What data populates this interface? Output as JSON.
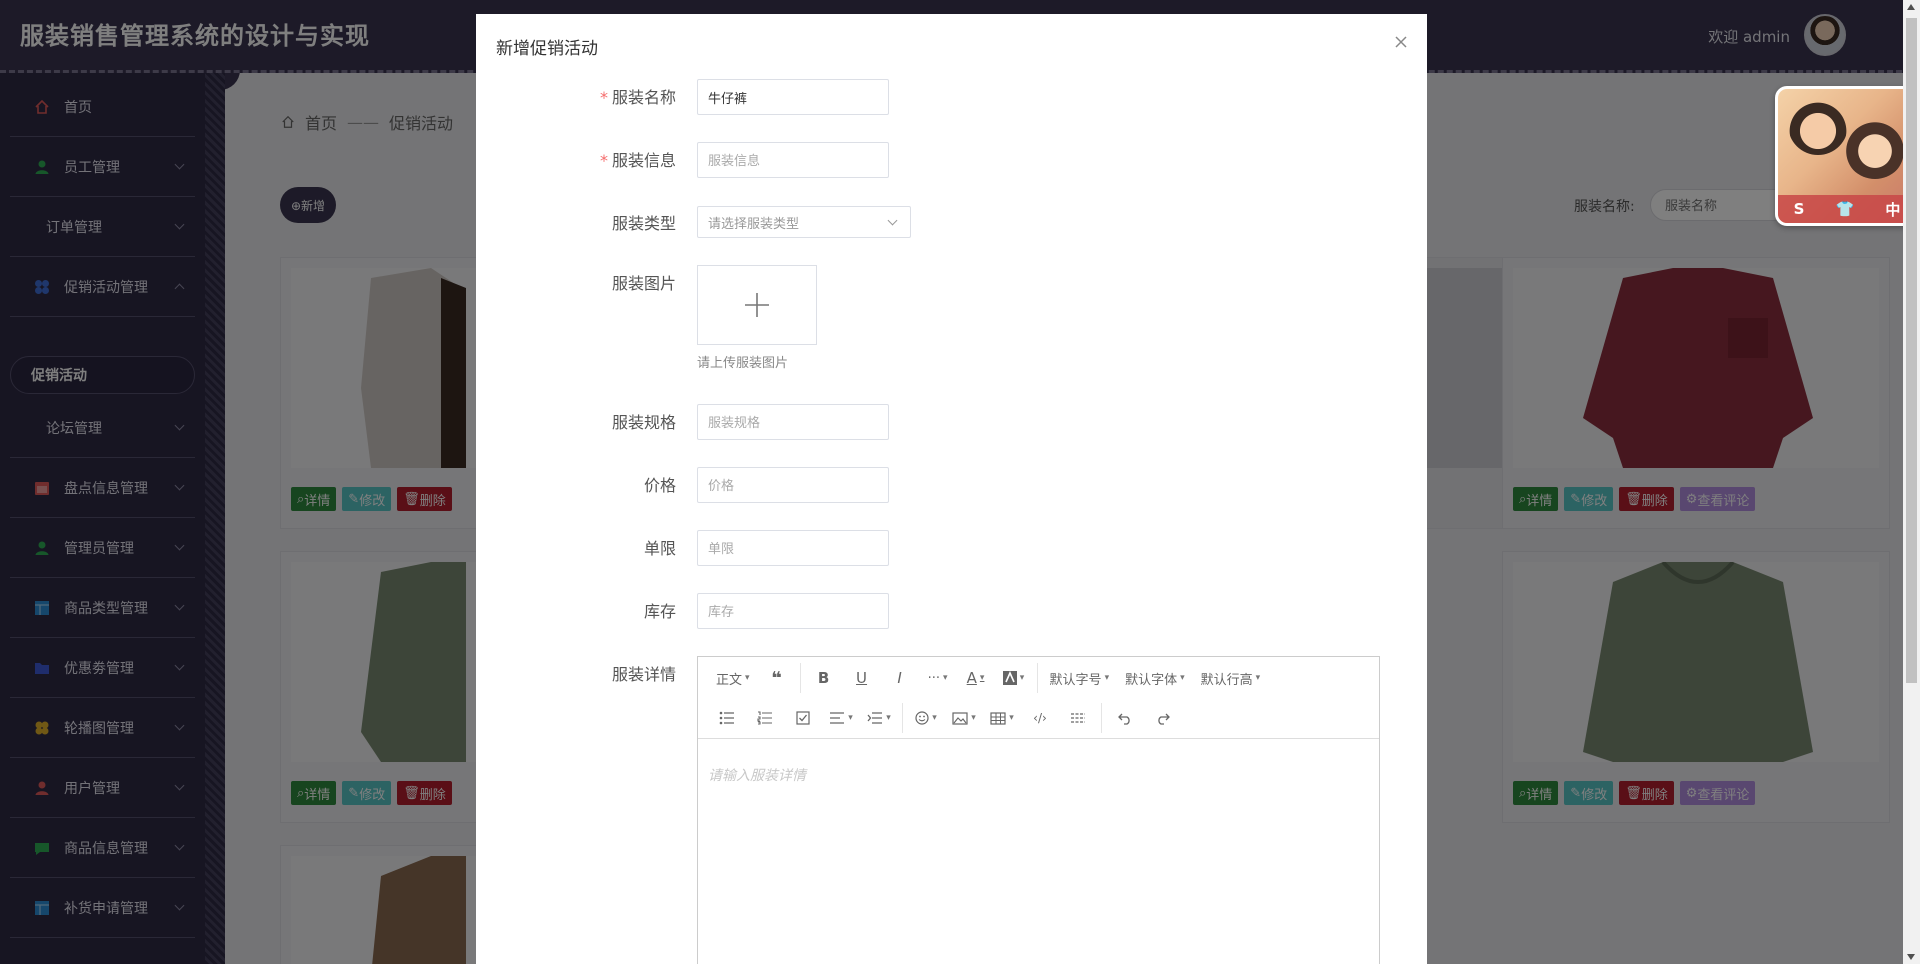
{
  "app": {
    "title": "服装销售管理系统的设计与实现",
    "welcome": "欢迎 admin"
  },
  "sidebar": {
    "items": [
      {
        "label": "首页",
        "icon": "home-icon",
        "color": "#e05a5a"
      },
      {
        "label": "员工管理",
        "icon": "person-icon",
        "color": "#2fae55"
      },
      {
        "label": "订单管理",
        "icon": "",
        "color": ""
      },
      {
        "label": "促销活动管理",
        "icon": "grid-icon",
        "color": "#3f6fd8"
      },
      {
        "label": "论坛管理",
        "icon": "",
        "color": ""
      },
      {
        "label": "盘点信息管理",
        "icon": "calendar-icon",
        "color": "#e05a5a"
      },
      {
        "label": "管理员管理",
        "icon": "person-icon",
        "color": "#2fae55"
      },
      {
        "label": "商品类型管理",
        "icon": "table-icon",
        "color": "#2d8fd8"
      },
      {
        "label": "优惠劵管理",
        "icon": "folder-icon",
        "color": "#3f5bd8"
      },
      {
        "label": "轮播图管理",
        "icon": "clover-icon",
        "color": "#e0b02a"
      },
      {
        "label": "用户管理",
        "icon": "person-icon",
        "color": "#e05a5a"
      },
      {
        "label": "商品信息管理",
        "icon": "chat-icon",
        "color": "#2fae55"
      },
      {
        "label": "补货申请管理",
        "icon": "table-icon",
        "color": "#2d8fd8"
      }
    ],
    "active_sub": "促销活动"
  },
  "breadcrumb": {
    "home": "首页",
    "current": "促销活动"
  },
  "toolbar": {
    "add_label": "⊕新增",
    "search_label": "服装名称:",
    "search_placeholder": "服装名称"
  },
  "card_actions": {
    "detail": "详情",
    "edit": "修改",
    "delete": "删除",
    "review": "查看评论"
  },
  "dialog": {
    "title": "新增促销活动",
    "fields": {
      "name": {
        "label": "服装名称",
        "value": "牛仔裤",
        "required": true
      },
      "info": {
        "label": "服装信息",
        "placeholder": "服装信息",
        "required": true
      },
      "type": {
        "label": "服装类型",
        "placeholder": "请选择服装类型"
      },
      "image": {
        "label": "服装图片",
        "tip": "请上传服装图片"
      },
      "spec": {
        "label": "服装规格",
        "placeholder": "服装规格"
      },
      "price": {
        "label": "价格",
        "placeholder": "价格"
      },
      "limit": {
        "label": "单限",
        "placeholder": "单限"
      },
      "stock": {
        "label": "库存",
        "placeholder": "库存"
      },
      "detail": {
        "label": "服装详情",
        "placeholder": "请输入服装详情"
      }
    },
    "editor_toolbar": {
      "heading": "正文",
      "font_size": "默认字号",
      "font_family": "默认字体",
      "line_height": "默认行高"
    }
  },
  "ad": {
    "chars": [
      "S",
      "中"
    ]
  },
  "colors": {
    "header": "#3a3550",
    "sidebar": "#2f2b45",
    "danger": "#b51f2e",
    "success": "#2e8b3e"
  }
}
